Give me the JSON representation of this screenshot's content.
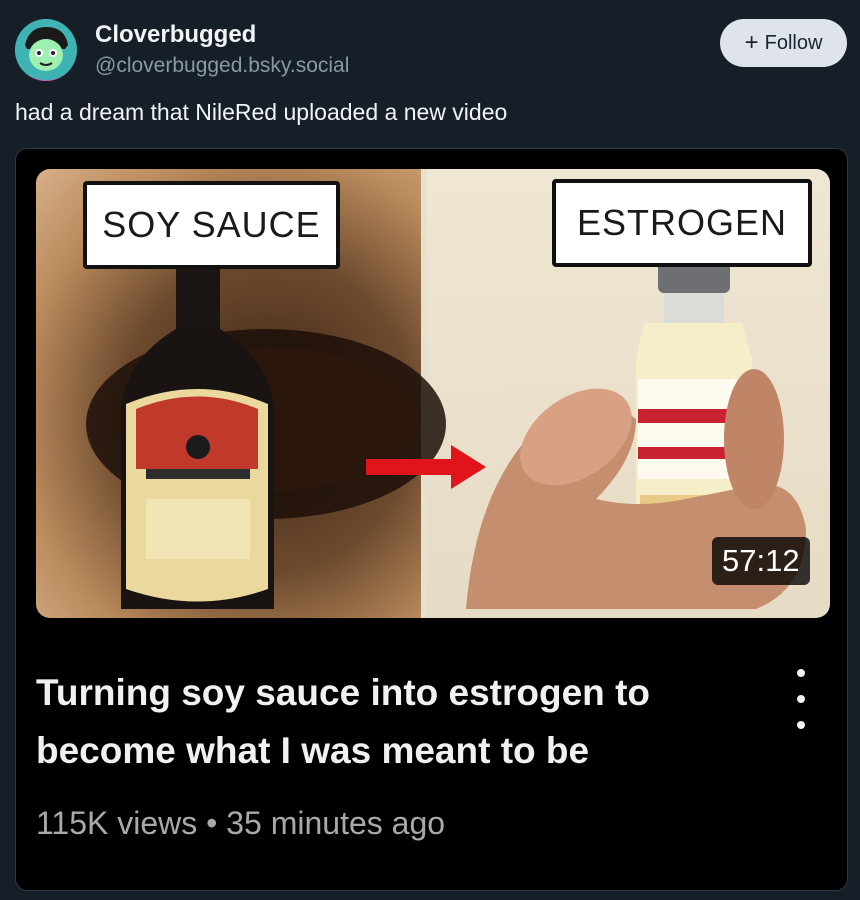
{
  "author": {
    "display_name": "Cloverbugged",
    "handle": "@cloverbugged.bsky.social",
    "avatar_icon": "avatar-icon"
  },
  "follow": {
    "label": "Follow",
    "icon": "plus-icon"
  },
  "post": {
    "text": "had a dream that NileRed uploaded a new video"
  },
  "video": {
    "left_label": "SOY SAUCE",
    "right_label": "ESTROGEN",
    "duration": "57:12",
    "title": "Turning soy sauce into estrogen to become what I was meant to be",
    "views": "115K views",
    "separator": "•",
    "age": "35 minutes ago",
    "more_icon": "more-vertical-icon"
  },
  "colors": {
    "background": "#161e27",
    "follow_bg": "#dfe4ea",
    "embed_bg": "#000000",
    "arrow": "#e0141a"
  }
}
